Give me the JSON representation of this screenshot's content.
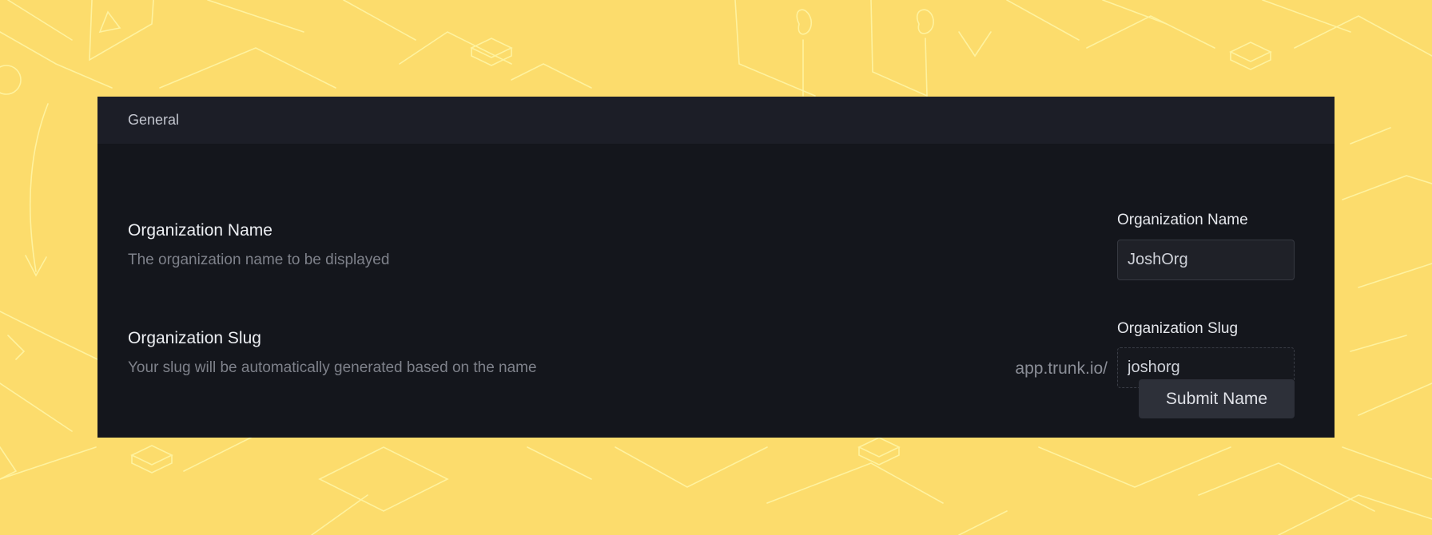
{
  "colors": {
    "background": "#fcdc6c",
    "sketch_lines": "#fff3a0",
    "panel": "#14161c",
    "panel_header": "#1c1e27",
    "button": "#2d3039"
  },
  "section": {
    "header_title": "General"
  },
  "org_name": {
    "title": "Organization Name",
    "description": "The organization name to be displayed",
    "field_label": "Organization Name",
    "value": "JoshOrg"
  },
  "org_slug": {
    "title": "Organization Slug",
    "description": "Your slug will be automatically generated based on the name",
    "prefix": "app.trunk.io/",
    "field_label": "Organization Slug",
    "value": "joshorg"
  },
  "actions": {
    "submit_label": "Submit Name"
  }
}
